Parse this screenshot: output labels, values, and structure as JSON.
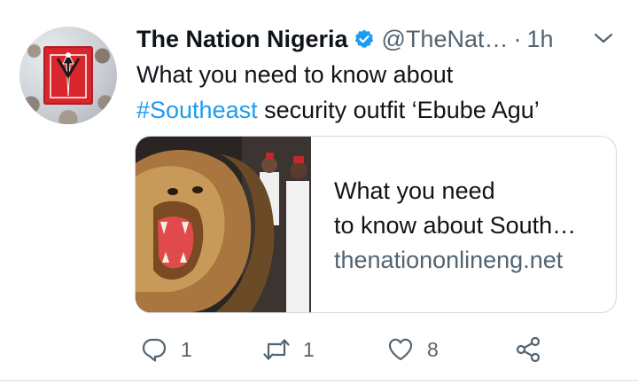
{
  "tweet": {
    "author_name": "The Nation Nigeria",
    "handle": "@TheNat…",
    "separator": "·",
    "time": "1h",
    "text_line1": "What you need to know about",
    "hashtag": "#Southeast",
    "text_rest": " security outfit ‘Ebube Agu’"
  },
  "card": {
    "title_line1": "What you need",
    "title_line2": "to know about South…",
    "domain": "thenationonlineng.net"
  },
  "actions": {
    "replies": "1",
    "retweets": "1",
    "likes": "8"
  },
  "colors": {
    "accent": "#1d9bf0",
    "secondary_text": "#536471",
    "logo_red": "#d8262c"
  },
  "icons": [
    "verified-badge-icon",
    "chevron-down-icon",
    "reply-icon",
    "retweet-icon",
    "like-icon",
    "share-icon"
  ]
}
